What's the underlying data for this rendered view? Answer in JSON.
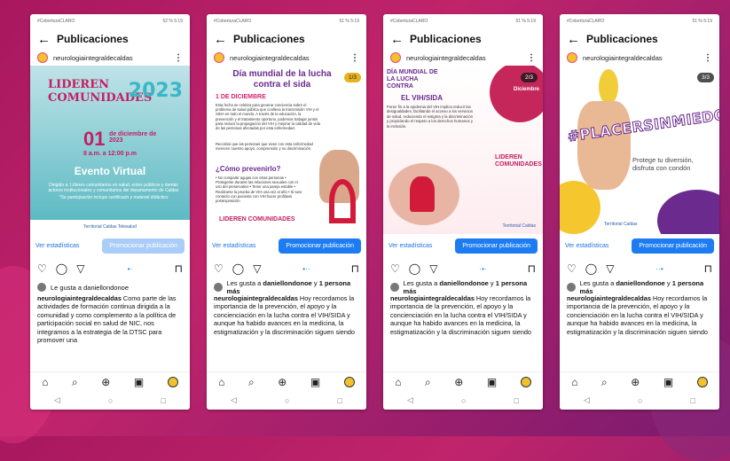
{
  "phones": [
    {
      "status": "#CoberturaCLARO",
      "status_right": "52 %  5:19",
      "title": "Publicaciones",
      "account": "neurologiaintegraldecaldas",
      "stats_label": "Ver estadísticas",
      "promo_label": "Promocionar publicación",
      "likes": "Le gusta a daniellondonoe",
      "caption_user": "neurologiaintegraldecaldas",
      "caption": "Como parte de las actividades de formación continua dirigida a la comunidad y como complemento a la política de participación social en salud de NIC, nos integramos a la estrategia de la DTSC para promover una",
      "post": {
        "headline": "LIDEREN COMUNIDADES",
        "year": "2023",
        "day": "01",
        "date_line": "de diciembre de 2023",
        "time": "8 a.m. a 12:00 p.m",
        "event": "Evento Virtual",
        "desc": "Dirigido a: Líderes comunitarios en salud, entes públicos y demás actores institucionales y comunitarios del departamento de Caldas",
        "note": "*Se participación incluye certificado y material didáctico",
        "footer": "Territorial  Caldas  Telesalud"
      }
    },
    {
      "status": "#CoberturaCLARO",
      "status_right": "51 %  5:19",
      "title": "Publicaciones",
      "account": "neurologiaintegraldecaldas",
      "badge": "1/3",
      "stats_label": "Ver estadísticas",
      "promo_label": "Promocionar publicación",
      "likes_prefix": "Les gusta a ",
      "likes_user": "daniellondonoe",
      "likes_mid": " y ",
      "likes_more": "1 persona más",
      "caption_user": "neurologiaintegraldecaldas",
      "caption": "Hoy recordamos la importancia de la prevención, el apoyo y la concienciación en la lucha contra el VIH/SIDA y aunque ha habido avances en la medicina, la estigmatización y la discriminación siguen siendo",
      "post": {
        "headline": "Día mundial de la lucha contra el sida",
        "date": "1 DE DICIEMBRE",
        "p1": "Esta fecha se celebra para generar conciencia sobre el problema de salud pública que conlleva la transmisión VIH y el SIDA en todo el mundo. A través de la educación, la prevención y el tratamiento oportuno, podemos trabajar juntos para reducir la propagación del VIH y mejorar la calidad de vida de las personas afectadas por esta enfermedad.",
        "p2": "Recordar que las personas que viven con esta enfermedad merecen nuestro apoyo, comprensión y no discriminación.",
        "question": "¿Cómo prevenirlo?",
        "bullets": "• No compartir agujas con otras personas  • Protegerse durante las relaciones sexuales con el uso del preservativo  • Tener una pareja estable  • Realizarse la prueba de VIH una vez al año  • Si tuvo contacto con paciente con VIH hacer profilaxis postexposición",
        "logo": "LIDEREN COMUNIDADES"
      }
    },
    {
      "status": "#CoberturaCLARO",
      "status_right": "51 %  5:19",
      "title": "Publicaciones",
      "account": "neurologiaintegraldecaldas",
      "badge": "2/3",
      "stats_label": "Ver estadísticas",
      "promo_label": "Promocionar publicación",
      "likes_prefix": "Les gusta a ",
      "likes_user": "daniellondonoe",
      "likes_mid": " y ",
      "likes_more": "1 persona más",
      "caption_user": "neurologiaintegraldecaldas",
      "caption": "Hoy recordamos la importancia de la prevención, el apoyo y la concienciación en la lucha contra el VIH/SIDA y aunque ha habido avances en la medicina, la estigmatización y la discriminación siguen siendo",
      "post": {
        "headline": "DÍA MUNDIAL DE LA LUCHA CONTRA",
        "headline2": "EL VIH/SIDA",
        "circle": "Diciembre",
        "body": "Poner fin a la epidemia del VIH implica reducir las desigualdades, facilitando el acceso a los servicios de salud, reduciendo el estigma y la discriminación y propiciando el respeto a los derechos humanos y la inclusión.",
        "logo": "LIDEREN COMUNIDADES",
        "footer": "Territorial  Caldas"
      }
    },
    {
      "status": "#CoberturaCLARO",
      "status_right": "51 %  5:19",
      "title": "Publicaciones",
      "account": "neurologiaintegraldecaldas",
      "badge": "3/3",
      "stats_label": "Ver estadísticas",
      "promo_label": "Promocionar publicación",
      "likes_prefix": "Les gusta a ",
      "likes_user": "daniellondonoe",
      "likes_mid": " y ",
      "likes_more": "1 persona más",
      "caption_user": "neurologiaintegraldecaldas",
      "caption": "Hoy recordamos la importancia de la prevención, el apoyo y la concienciación en la lucha contra el VIH/SIDA y aunque ha habido avances en la medicina, la estigmatización y la discriminación siguen siendo",
      "post": {
        "hashtag": "#PLACERSINMIEDO",
        "tagline": "Protege tu diversión, disfruta con condón",
        "footer": "Territorial  Caldas"
      }
    }
  ],
  "icons": {
    "back": "←",
    "more": "⋮",
    "like": "♡",
    "comment": "◯",
    "share": "▽",
    "save": "⊓",
    "home": "⌂",
    "search": "⌕",
    "add": "⊕",
    "reels": "▣",
    "back_sys": "◁",
    "home_sys": "○",
    "recent_sys": "□"
  },
  "colors": {
    "accent": "#1d7cf2",
    "magenta": "#c31e63",
    "purple": "#6a2a8f"
  }
}
